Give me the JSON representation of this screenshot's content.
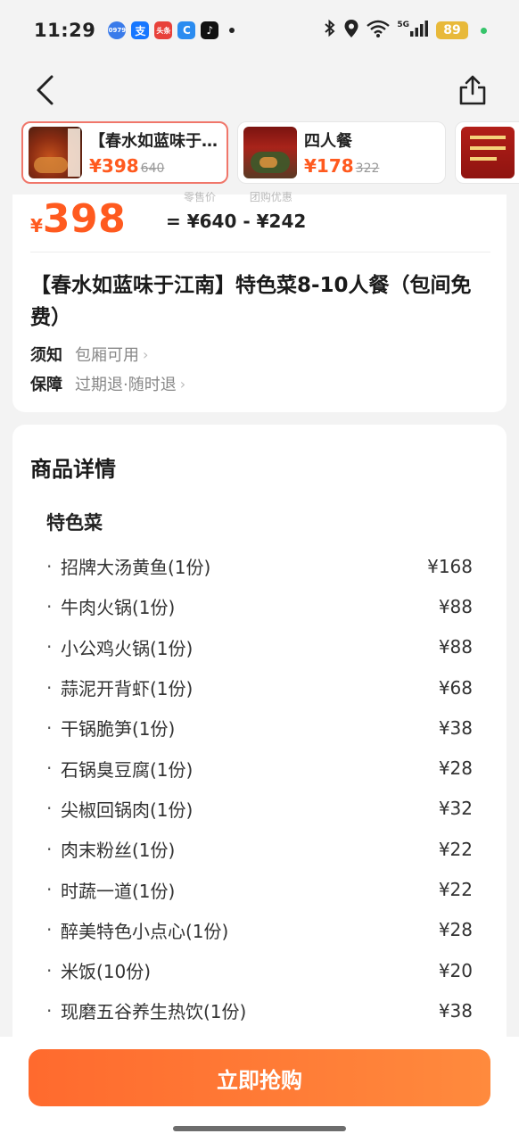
{
  "status_bar": {
    "time": "11:29",
    "network": "5G",
    "battery": "89",
    "apps": [
      {
        "name": "app-icon-1",
        "label": "0979",
        "color": "#3a7bea"
      },
      {
        "name": "alipay-icon",
        "label": "支",
        "color": "#1677ff"
      },
      {
        "name": "toutiao-icon",
        "label": "头条",
        "color": "#e8413a"
      },
      {
        "name": "app-icon-4",
        "label": "C",
        "color": "#2b8cf0"
      },
      {
        "name": "tiktok-icon",
        "label": "♪",
        "color": "#111111"
      }
    ]
  },
  "packages": [
    {
      "name": "【春水如蓝味于…",
      "price": "¥398",
      "original": "640"
    },
    {
      "name": "四人餐",
      "price": "¥178",
      "original": "322"
    },
    {
      "name": "",
      "price": "",
      "original": ""
    }
  ],
  "pricing": {
    "symbol": "¥",
    "price": "398",
    "equation": "= ¥640 - ¥242",
    "caption_original": "零售价",
    "caption_discount": "团购优惠"
  },
  "deal": {
    "title": "【春水如蓝味于江南】特色菜8-10人餐（包间免费）",
    "notice_label": "须知",
    "notice_value": "包厢可用",
    "guarantee_label": "保障",
    "guarantee_value": "过期退·随时退"
  },
  "details": {
    "title": "商品详情",
    "group": "特色菜",
    "items": [
      {
        "name": "招牌大汤黄鱼(1份)",
        "price": "¥168"
      },
      {
        "name": "牛肉火锅(1份)",
        "price": "¥88"
      },
      {
        "name": "小公鸡火锅(1份)",
        "price": "¥88"
      },
      {
        "name": "蒜泥开背虾(1份)",
        "price": "¥68"
      },
      {
        "name": "干锅脆笋(1份)",
        "price": "¥38"
      },
      {
        "name": "石锅臭豆腐(1份)",
        "price": "¥28"
      },
      {
        "name": "尖椒回锅肉(1份)",
        "price": "¥32"
      },
      {
        "name": "肉末粉丝(1份)",
        "price": "¥22"
      },
      {
        "name": "时蔬一道(1份)",
        "price": "¥22"
      },
      {
        "name": "醉美特色小点心(1份)",
        "price": "¥28"
      },
      {
        "name": "米饭(10份)",
        "price": "¥20"
      },
      {
        "name": "现磨五谷养生热饮(1份)",
        "price": "¥38"
      }
    ]
  },
  "bottom": {
    "buy_label": "立即抢购"
  },
  "colors": {
    "accent": "#ff5a1f",
    "button_start": "#ff6a2e",
    "button_end": "#ff8a3d"
  }
}
